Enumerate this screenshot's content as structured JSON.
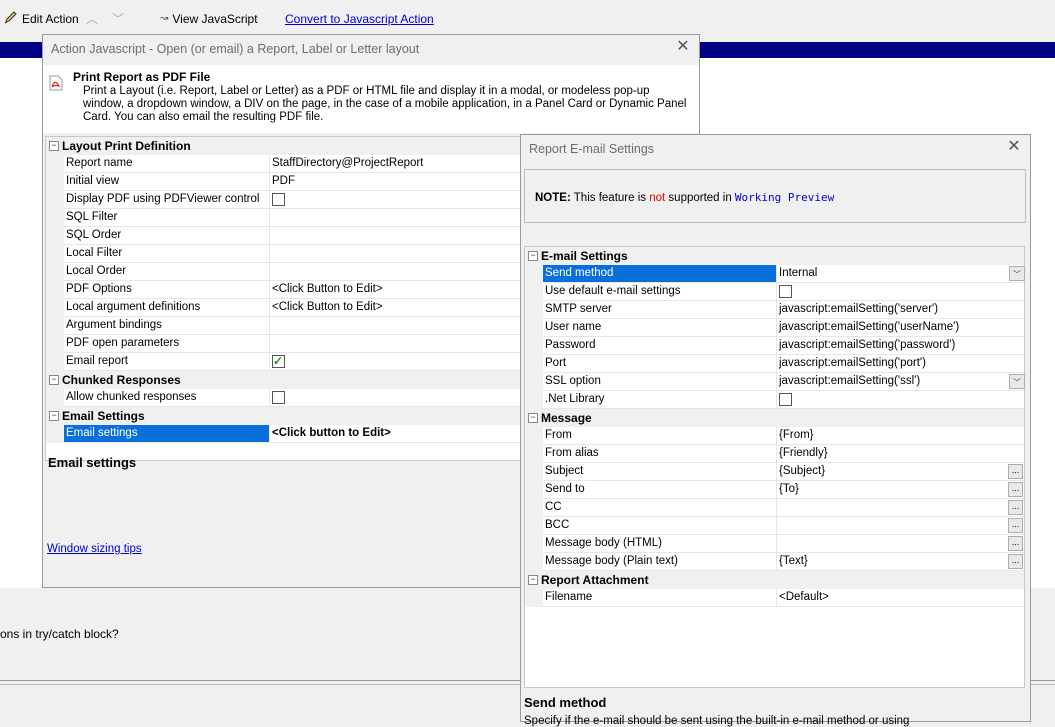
{
  "toolbar": {
    "edit_action": "Edit Action",
    "view_js": "View JavaScript",
    "convert_link": "Convert to Javascript Action"
  },
  "background": {
    "try_catch_text": "ons in try/catch block?"
  },
  "dialog1": {
    "title": "Action Javascript - Open (or email) a Report, Label or Letter layout",
    "info_title": "Print Report as PDF File",
    "info_desc": "Print a Layout (i.e. Report, Label or Letter) as a PDF or HTML file and display it in a modal, or modeless pop-up window, a dropdown window, a DIV on the page, in the case of a mobile application, in a Panel Card or Dynamic Panel Card. You can also email the resulting PDF file.",
    "sections": {
      "layout": "Layout Print Definition",
      "chunked": "Chunked Responses",
      "email": "Email Settings"
    },
    "rows": {
      "report_name": {
        "label": "Report name",
        "value": "StaffDirectory@ProjectReport"
      },
      "initial_view": {
        "label": "Initial view",
        "value": "PDF"
      },
      "display_pdf": {
        "label": "Display PDF using PDFViewer control",
        "checked": false
      },
      "sql_filter": {
        "label": "SQL Filter",
        "value": ""
      },
      "sql_order": {
        "label": "SQL Order",
        "value": ""
      },
      "local_filter": {
        "label": "Local Filter",
        "value": ""
      },
      "local_order": {
        "label": "Local Order",
        "value": ""
      },
      "pdf_options": {
        "label": "PDF Options",
        "value": "<Click Button to Edit>"
      },
      "local_args": {
        "label": "Local argument definitions",
        "value": "<Click Button to Edit>"
      },
      "arg_bindings": {
        "label": "Argument bindings",
        "value": ""
      },
      "pdf_open_params": {
        "label": "PDF open parameters",
        "value": ""
      },
      "email_report": {
        "label": "Email report",
        "checked": true
      },
      "allow_chunked": {
        "label": "Allow chunked responses",
        "checked": false
      },
      "email_settings": {
        "label": "Email settings",
        "value": "<Click button to Edit>"
      }
    },
    "desc_title": "Email settings",
    "window_tips": "Window sizing tips"
  },
  "dialog2": {
    "title": "Report E-mail Settings",
    "note_label": "NOTE:",
    "note_pre": "This feature is",
    "note_not": "not",
    "note_mid": "supported in",
    "note_mono": "Working Preview",
    "sections": {
      "email": "E-mail Settings",
      "message": "Message",
      "attachment": "Report Attachment"
    },
    "rows": {
      "send_method": {
        "label": "Send method",
        "value": "Internal"
      },
      "use_default": {
        "label": "Use default e-mail settings",
        "checked": false
      },
      "smtp": {
        "label": "SMTP server",
        "value": "javascript:emailSetting('server')"
      },
      "username": {
        "label": "User name",
        "value": "javascript:emailSetting('userName')"
      },
      "password": {
        "label": "Password",
        "value": "javascript:emailSetting('password')"
      },
      "port": {
        "label": "Port",
        "value": "javascript:emailSetting('port')"
      },
      "ssl": {
        "label": "SSL option",
        "value": "javascript:emailSetting('ssl')"
      },
      "netlib": {
        "label": ".Net Library",
        "checked": false
      },
      "from": {
        "label": "From",
        "value": "{From}"
      },
      "from_alias": {
        "label": "From alias",
        "value": "{Friendly}"
      },
      "subject": {
        "label": "Subject",
        "value": "{Subject}"
      },
      "send_to": {
        "label": "Send to",
        "value": "{To}"
      },
      "cc": {
        "label": "CC",
        "value": ""
      },
      "bcc": {
        "label": "BCC",
        "value": ""
      },
      "body_html": {
        "label": "Message body (HTML)",
        "value": ""
      },
      "body_text": {
        "label": "Message body (Plain text)",
        "value": "{Text}"
      },
      "filename": {
        "label": "Filename",
        "value": "<Default>"
      }
    },
    "desc_title": "Send method",
    "desc_text": "Specify if the e-mail should be sent using the built-in e-mail method or using"
  }
}
